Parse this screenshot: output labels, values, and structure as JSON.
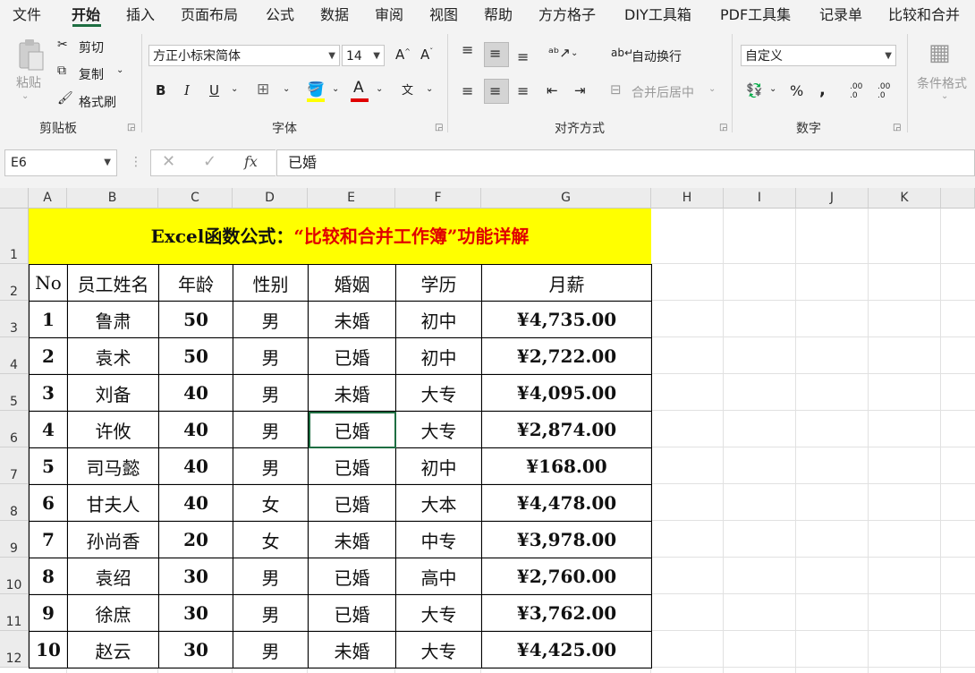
{
  "menu": [
    "文件",
    "开始",
    "插入",
    "页面布局",
    "公式",
    "数据",
    "审阅",
    "视图",
    "帮助",
    "方方格子",
    "DIY工具箱",
    "PDF工具集",
    "记录单",
    "比较和合并"
  ],
  "ribbon": {
    "clipboard": {
      "paste": "粘贴",
      "cut": "剪切",
      "copy": "复制",
      "format_painter": "格式刷",
      "label": "剪贴板"
    },
    "font": {
      "name": "方正小标宋简体",
      "size": "14",
      "label": "字体"
    },
    "align": {
      "wrap": "自动换行",
      "merge": "合并后居中",
      "label": "对齐方式"
    },
    "number": {
      "format": "自定义",
      "label": "数字"
    },
    "styles": {
      "conditional": "条件格式"
    }
  },
  "formula_bar": {
    "name_box": "E6",
    "formula": "已婚",
    "fx": "fx"
  },
  "columns": [
    "A",
    "B",
    "C",
    "D",
    "E",
    "F",
    "G",
    "H",
    "I",
    "J",
    "K"
  ],
  "rows": [
    "1",
    "2",
    "3",
    "4",
    "5",
    "6",
    "7",
    "8",
    "9",
    "10",
    "11",
    "12"
  ],
  "sheet": {
    "title_black": "Excel函数公式：",
    "title_red": "“比较和合并工作簿”功能详解",
    "headers": [
      "No",
      "员工姓名",
      "年龄",
      "性别",
      "婚姻",
      "学历",
      "月薪"
    ],
    "records": [
      [
        "1",
        "鲁肃",
        "50",
        "男",
        "未婚",
        "初中",
        "¥4,735.00"
      ],
      [
        "2",
        "袁术",
        "50",
        "男",
        "已婚",
        "初中",
        "¥2,722.00"
      ],
      [
        "3",
        "刘备",
        "40",
        "男",
        "未婚",
        "大专",
        "¥4,095.00"
      ],
      [
        "4",
        "许攸",
        "40",
        "男",
        "已婚",
        "大专",
        "¥2,874.00"
      ],
      [
        "5",
        "司马懿",
        "40",
        "男",
        "已婚",
        "初中",
        "¥168.00"
      ],
      [
        "6",
        "甘夫人",
        "40",
        "女",
        "已婚",
        "大本",
        "¥4,478.00"
      ],
      [
        "7",
        "孙尚香",
        "20",
        "女",
        "未婚",
        "中专",
        "¥3,978.00"
      ],
      [
        "8",
        "袁绍",
        "30",
        "男",
        "已婚",
        "高中",
        "¥2,760.00"
      ],
      [
        "9",
        "徐庶",
        "30",
        "男",
        "已婚",
        "大专",
        "¥3,762.00"
      ],
      [
        "10",
        "赵云",
        "30",
        "男",
        "未婚",
        "大专",
        "¥4,425.00"
      ]
    ]
  },
  "selected_cell": "E6"
}
